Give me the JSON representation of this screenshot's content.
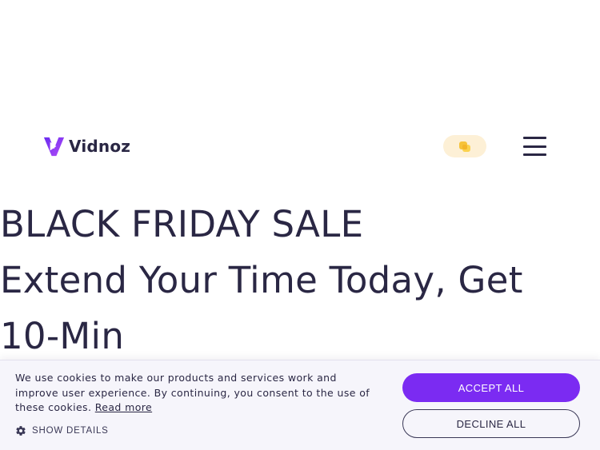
{
  "header": {
    "logo_text": "Vidnoz",
    "promo_icon": "gift-coupon-icon",
    "menu_icon": "hamburger-menu-icon"
  },
  "hero": {
    "line1": "BLACK FRIDAY SALE",
    "line2": "Extend Your Time Today, Get",
    "line3": "10-Min"
  },
  "cookie": {
    "message": "We use cookies to make our products and services work and improve user experience. By continuing, you consent to the use of these cookies.",
    "read_more": "Read more",
    "show_details": "SHOW DETAILS",
    "accept_all": "ACCEPT ALL",
    "decline_all": "DECLINE ALL"
  },
  "colors": {
    "brand_purple": "#7b2bf2",
    "text_dark": "#2a2744",
    "promo_bg": "#fdf0d6",
    "banner_bg": "#f6f5fb"
  }
}
